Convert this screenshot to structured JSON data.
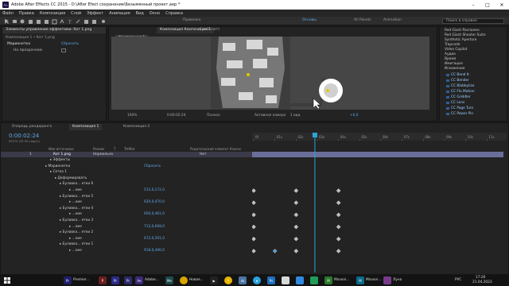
{
  "titlebar": {
    "icon": "Ae",
    "title": "Adobe After Effects CC 2015 - D:\\After Efect сохранение\\Безымянный проект.aep *"
  },
  "menu": [
    "Файл",
    "Правка",
    "Композиция",
    "Слой",
    "Эффект",
    "Анимация",
    "Вид",
    "Окно",
    "Справка"
  ],
  "toolbar": {
    "workspaces": [
      "Привязка",
      "Основы",
      "All Panels",
      "Animation"
    ],
    "active_workspace": "Основы",
    "search_placeholder": "Поиск в справке"
  },
  "effects_panel": {
    "tab": "Элементы управления эффектами: Кот 1.png",
    "header": "Композиция 1 • Кот 1.png",
    "effect_name": "Марионетка",
    "reset_label": "Сбросить",
    "param_label": "На прозрачном",
    "param_value": ""
  },
  "viewer": {
    "tabs": [
      "Композиция Композиция 1",
      "Слой (нет)"
    ],
    "comp_tab": "Композиция 1",
    "zoom": "100%",
    "timecode": "0:00:02:24",
    "quality": "Полное",
    "camera": "Активная камера",
    "views": "1 вид",
    "exposure": "+0,0"
  },
  "effects_presets": {
    "items": [
      "Red Giant Распален",
      "Red Giant Shooter Suite",
      "Synthetic Aperture",
      "Trapcode",
      "Video Copilot",
      "Аудио",
      "Время",
      "Имитация",
      "Искажение"
    ],
    "sub_items": [
      "CC Bend It",
      "CC Bender",
      "CC Blobbylize",
      "CC Flo Motion",
      "CC Griddler",
      "CC Lens",
      "CC Page Turn",
      "CC Power Pin"
    ]
  },
  "timeline": {
    "tabs": [
      "Очередь рендеринга",
      "Композиция 1",
      "Композиция 2"
    ],
    "active_tab": "Композиция 1",
    "timecode": "0:00:02:24",
    "frames_info": "00074 (25.00 кадр/с)",
    "columns": [
      "Имя источника",
      "Режим",
      "T",
      "TrkMat",
      "Родительский элемент",
      "Ключи"
    ],
    "ruler_labels": [
      "0f",
      "01s",
      "02s",
      "03s",
      "04s",
      "05s",
      "06s",
      "07s",
      "08s",
      "09s",
      "10s",
      "11s"
    ],
    "layer": {
      "index": "1",
      "name": "Кот 1.png",
      "mode": "Нормально",
      "parent": "Нет"
    },
    "rows": [
      {
        "label": "Эффекты",
        "value": ""
      },
      {
        "label": "Марионетка",
        "value": "Сбросить"
      },
      {
        "label": "Сетка 1",
        "value": ""
      },
      {
        "label": "Деформировать",
        "value": ""
      },
      {
        "label": "Булавка... етки 6",
        "value": ""
      },
      {
        "label": "...ние",
        "value": "515,0,172,0"
      },
      {
        "label": "Булавка... етки 5",
        "value": ""
      },
      {
        "label": "...ние",
        "value": "620,0,470,0"
      },
      {
        "label": "Булавка... етки 4",
        "value": ""
      },
      {
        "label": "...ние",
        "value": "600,0,461,0"
      },
      {
        "label": "Булавка... етки 3",
        "value": ""
      },
      {
        "label": "...ние",
        "value": "712,0,668,0"
      },
      {
        "label": "Булавка... етки 2",
        "value": ""
      },
      {
        "label": "...ние",
        "value": "672,0,591,0"
      },
      {
        "label": "Булавка... етки 1",
        "value": ""
      },
      {
        "label": "...ние",
        "value": "918,6,490,0"
      }
    ],
    "playhead_seconds": 2.96
  },
  "taskbar": {
    "items": [
      "Premier...",
      "Adobe...",
      "Новая...",
      "Movavi...",
      "Movavi...",
      "Луна"
    ],
    "tray_lang": "РУС",
    "clock_time": "17:26",
    "clock_date": "21.04.2023"
  },
  "colors": {
    "accent": "#2d8ceb",
    "playhead": "#2aa4d6",
    "bg": "#1d1d1d"
  }
}
